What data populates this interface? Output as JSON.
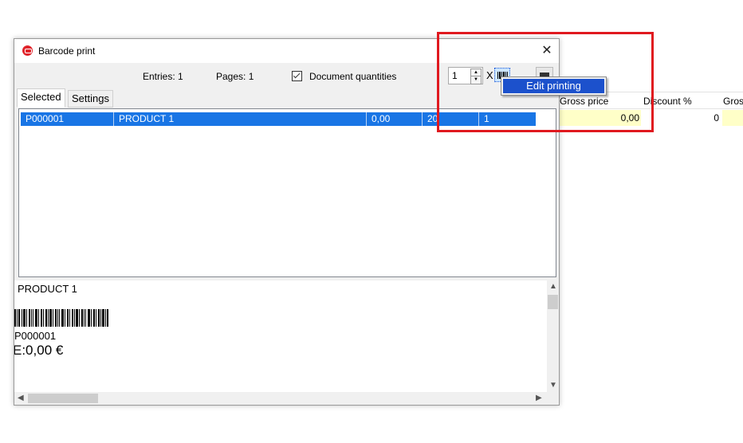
{
  "background_grid": {
    "headers": [
      "Gross price",
      "Discount %",
      "Gros"
    ],
    "row": {
      "gross_price": "0,00",
      "discount": "0"
    }
  },
  "dialog": {
    "title": "Barcode print",
    "entries": "Entries: 1",
    "pages": "Pages: 1",
    "document_quantities_label": "Document quantities",
    "document_quantities_checked": true,
    "copies_value": "1",
    "times_label": "X",
    "tabs": [
      "Selected",
      "Settings"
    ],
    "row": [
      "P000001",
      "PRODUCT 1",
      "0,00",
      "20",
      "1"
    ],
    "preview": {
      "title": "PRODUCT 1",
      "code": "P000001",
      "price": "E:0,00 €"
    }
  },
  "context_menu": {
    "item": "Edit printing"
  },
  "colors": {
    "highlight": "#1975e5",
    "menu_highlight": "#1c51cc",
    "annotation": "#e0191f",
    "input_yellow": "#ffffc8"
  }
}
